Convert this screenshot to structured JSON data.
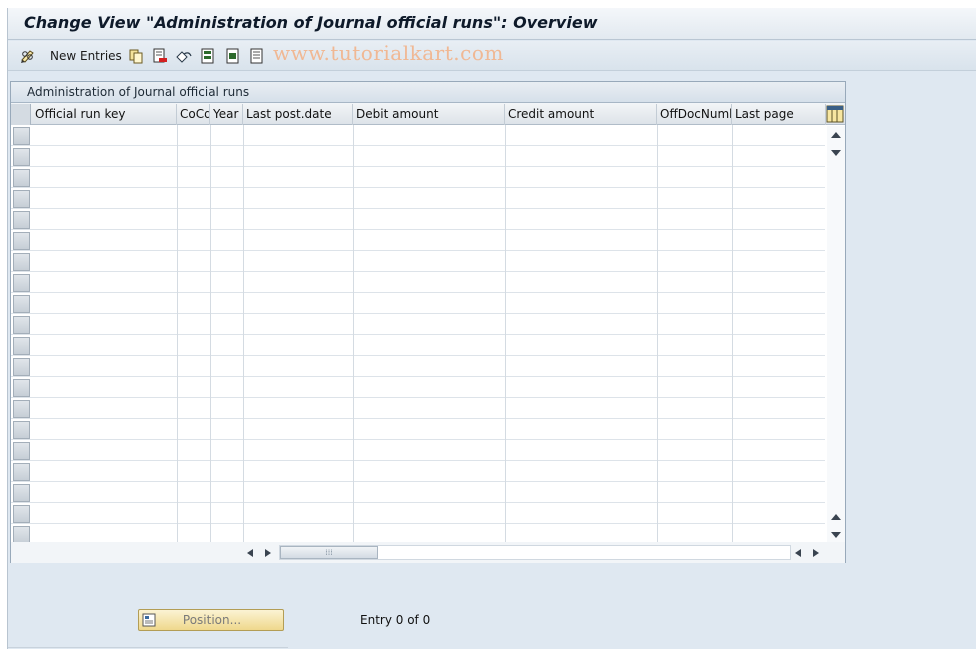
{
  "window": {
    "title": "Change View \"Administration of Journal official runs\": Overview"
  },
  "toolbar": {
    "new_entries_label": "New Entries",
    "watermark": "www.tutorialkart.com",
    "icons": [
      "edit-glasses-icon",
      "copy-icon",
      "delete-icon",
      "undo-icon",
      "select-all-icon",
      "select-block-icon",
      "deselect-all-icon"
    ]
  },
  "table": {
    "caption": "Administration of Journal official runs",
    "columns": [
      "Official run key",
      "CoCd",
      "Year",
      "Last post.date",
      "Debit amount",
      "Credit amount",
      "OffDocNumb",
      "Last page"
    ],
    "rows": []
  },
  "footer": {
    "position_label": "Position...",
    "entry_info": "Entry 0 of 0"
  },
  "colors": {
    "background": "#dfe8f1",
    "position_button": "#efd88c",
    "watermark": "#f0b894"
  }
}
